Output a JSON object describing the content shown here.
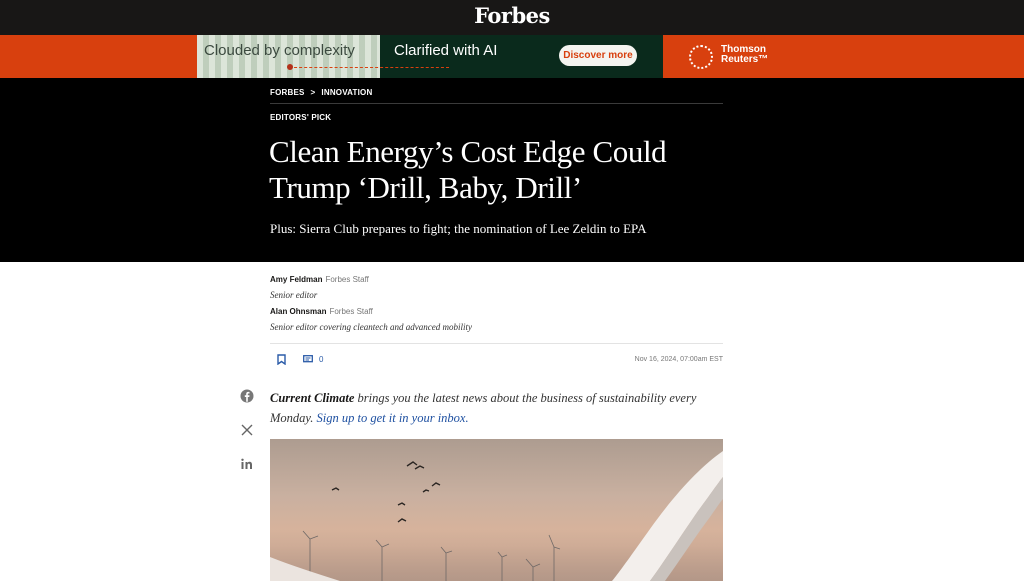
{
  "site": {
    "logo": "Forbes"
  },
  "ad": {
    "left_text": "Clouded by complexity",
    "middle_text": "Clarified with AI",
    "cta": "Discover more",
    "brand_line1": "Thomson",
    "brand_line2": "Reuters™"
  },
  "breadcrumb": {
    "section": "FORBES",
    "separator": ">",
    "subsection": "INNOVATION"
  },
  "article": {
    "label": "EDITORS' PICK",
    "headline_line1": "Clean Energy’s Cost Edge Could",
    "headline_line2": "Trump ‘Drill, Baby, Drill’",
    "dek": "Plus: Sierra Club prepares to fight; the nomination of Lee Zeldin to EPA",
    "authors": [
      {
        "name": "Amy Feldman",
        "affiliation": "Forbes Staff",
        "role": "Senior editor"
      },
      {
        "name": "Alan Ohnsman",
        "affiliation": "Forbes Staff",
        "role": "Senior editor covering cleantech and advanced mobility"
      }
    ],
    "comment_count": "0",
    "published": "Nov 16, 2024, 07:00am EST",
    "intro_bold": "Current Climate",
    "intro_text": " brings you the latest news about the business of sustainability every Monday. ",
    "intro_link": "Sign up to get it in your inbox."
  },
  "share": {
    "icons": [
      "facebook-icon",
      "x-icon",
      "linkedin-icon"
    ]
  },
  "colors": {
    "accent": "#d8400e",
    "hero_bg": "#000000",
    "link": "#1d4fa0"
  }
}
